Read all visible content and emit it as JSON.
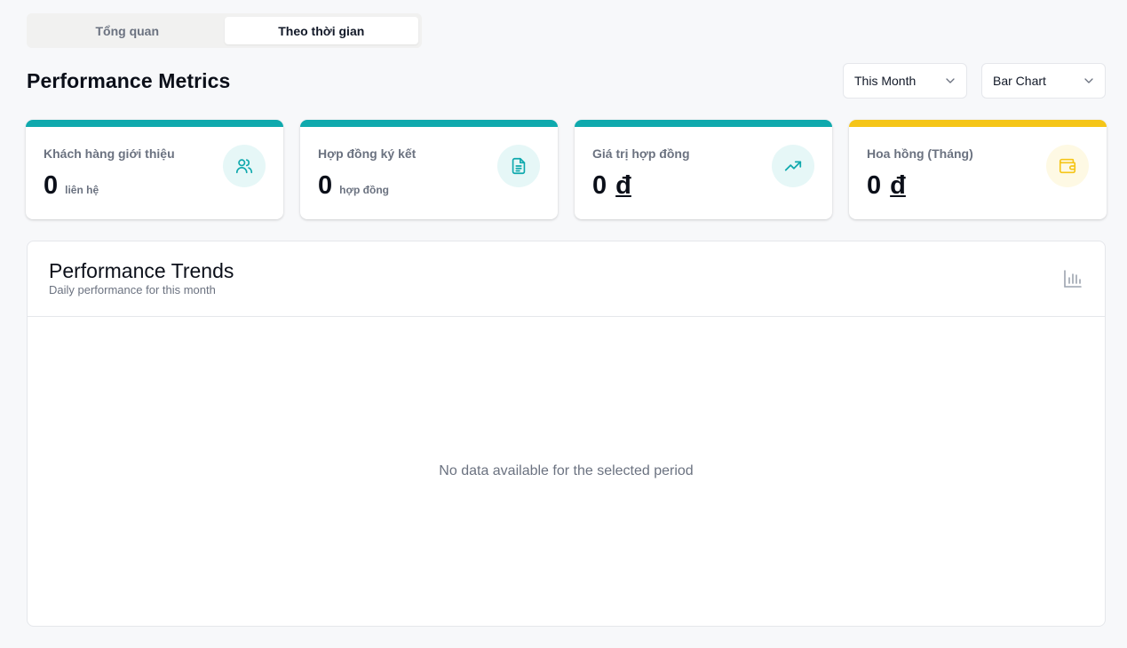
{
  "tabs": [
    {
      "label": "Tổng quan",
      "active": false
    },
    {
      "label": "Theo thời gian",
      "active": true
    }
  ],
  "header": {
    "title": "Performance Metrics",
    "period_select": "This Month",
    "chart_type_select": "Bar Chart"
  },
  "metrics": [
    {
      "label": "Khách hàng giới thiệu",
      "value": "0",
      "unit": "liên hệ",
      "icon": "users-icon",
      "accent": "#0fa9ad",
      "icon_bg": "#e6f7f7"
    },
    {
      "label": "Hợp đồng ký kết",
      "value": "0",
      "unit": "hợp đồng",
      "icon": "document-icon",
      "accent": "#0fa9ad",
      "icon_bg": "#e6f7f7"
    },
    {
      "label": "Giá trị hợp đồng",
      "value": "0",
      "currency": "đ",
      "icon": "trending-up-icon",
      "accent": "#0fa9ad",
      "icon_bg": "#e6f7f7"
    },
    {
      "label": "Hoa hồng (Tháng)",
      "value": "0",
      "currency": "đ",
      "icon": "wallet-icon",
      "accent": "#f5c518",
      "icon_bg": "#fef9e4"
    }
  ],
  "trends": {
    "title": "Performance Trends",
    "subtitle": "Daily performance for this month",
    "empty_message": "No data available for the selected period",
    "icon": "bar-chart-icon"
  },
  "colors": {
    "teal": "#0fa9ad",
    "yellow": "#f5c518"
  }
}
